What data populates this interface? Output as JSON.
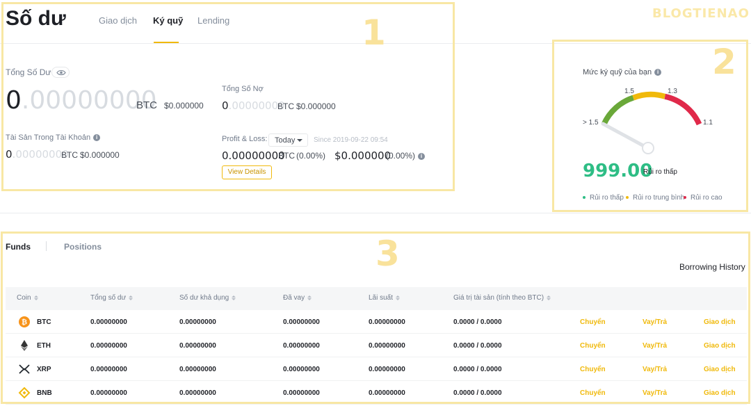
{
  "watermark": "BLOGTIENAO",
  "annotations": {
    "box1": "1",
    "box2": "2",
    "box3": "3"
  },
  "header": {
    "title": "Số dư",
    "tabs": [
      {
        "label": "Giao dịch",
        "active": false
      },
      {
        "label": "Ký quỹ",
        "active": true
      },
      {
        "label": "Lending",
        "active": false
      }
    ]
  },
  "balance": {
    "total_label": "Tổng Số Dư",
    "total_lead": "0",
    "total_tail": ".00000000",
    "total_unit": "BTC",
    "total_usd": "$0.000000",
    "debt_label": "Tổng Số Nợ",
    "debt_lead": "0",
    "debt_tail": ".00000000",
    "debt_unit": "BTC",
    "debt_usd": "$0.000000",
    "assets_label": "Tài Sản Trong Tài Khoản",
    "assets_lead": "0",
    "assets_tail": ".00000000",
    "assets_unit": "BTC",
    "assets_usd": "$0.000000",
    "pl_label": "Profit & Loss:",
    "pl_period": "Today",
    "pl_since": "Since 2019-09-22 09:54",
    "pl_btc": "0.00000000",
    "pl_btc_unit": "BTC",
    "pl_btc_pct": "(0.00%)",
    "pl_usd": "$0.000000",
    "pl_usd_pct": "(0.00%)",
    "view_details": "View Details"
  },
  "margin_level": {
    "title": "Mức ký quỹ của bạn",
    "gauge_labels": {
      "left": "> 1.5",
      "top_left": "1.5",
      "top_right": "1.3",
      "right": "1.1"
    },
    "score": "999.00",
    "risk_text": "Rủi ro thấp",
    "needle_level": 0.05,
    "legend": [
      {
        "label": "Rủi ro thấp",
        "color": "#2ebd85"
      },
      {
        "label": "Rủi ro trung bình",
        "color": "#f0b90b"
      },
      {
        "label": "Rủi ro cao",
        "color": "#e0294a"
      }
    ],
    "colors": {
      "green": "#6aa839",
      "yellow": "#f0b90b",
      "red": "#e0294a"
    }
  },
  "funds": {
    "tabs": [
      {
        "label": "Funds",
        "active": true
      },
      {
        "label": "Positions",
        "active": false
      }
    ],
    "borrowing_history": "Borrowing History",
    "columns": [
      "Coin",
      "Tổng số dư",
      "Số dư khả dụng",
      "Đã vay",
      "Lãi suất",
      "Giá trị tài sản (tính theo BTC)"
    ],
    "rows": [
      {
        "coin": "BTC",
        "icon": "btc-icon",
        "total": "0.00000000",
        "available": "0.00000000",
        "borrowed": "0.00000000",
        "interest": "0.00000000",
        "value": "0.0000 / 0.0000"
      },
      {
        "coin": "ETH",
        "icon": "eth-icon",
        "total": "0.00000000",
        "available": "0.00000000",
        "borrowed": "0.00000000",
        "interest": "0.00000000",
        "value": "0.0000 / 0.0000"
      },
      {
        "coin": "XRP",
        "icon": "xrp-icon",
        "total": "0.00000000",
        "available": "0.00000000",
        "borrowed": "0.00000000",
        "interest": "0.00000000",
        "value": "0.0000 / 0.0000"
      },
      {
        "coin": "BNB",
        "icon": "bnb-icon",
        "total": "0.00000000",
        "available": "0.00000000",
        "borrowed": "0.00000000",
        "interest": "0.00000000",
        "value": "0.0000 / 0.0000"
      }
    ],
    "actions": {
      "transfer": "Chuyển",
      "borrow": "Vay/Trả",
      "trade": "Giao dịch"
    }
  }
}
